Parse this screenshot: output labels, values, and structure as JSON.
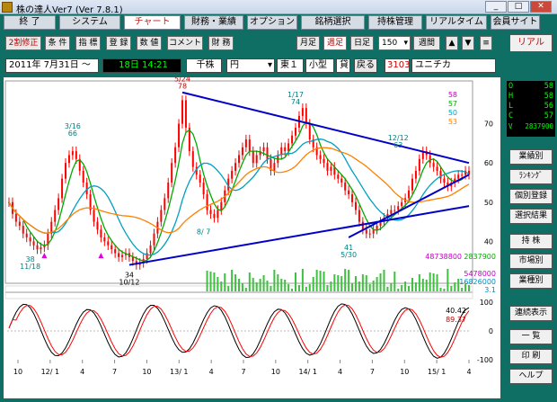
{
  "window": {
    "title": "株の達人Ver7 (Ver 7.8.1)"
  },
  "menu": {
    "items": [
      "終 了",
      "システム",
      "チャート",
      "財務・業績",
      "オプション",
      "銘柄選択",
      "持株管理",
      "リアルタイム",
      "会員サイト"
    ],
    "active_index": 2
  },
  "toolbar": {
    "split_label": "2割修正",
    "condition_label": "条 件",
    "indicator_label": "指 標",
    "register_label": "登 録",
    "value_label": "数 値",
    "comment_label": "コメント",
    "finance_label": "財 務",
    "monthly_label": "月足",
    "weekly_label": "週足",
    "daily_label": "日足",
    "bars_value": "150",
    "period_label": "週間",
    "up_label": "▲",
    "down_label": "▼",
    "menu_label": "≡"
  },
  "info": {
    "date": "2011年 7月31日 ～",
    "range_end": "18日 14:21",
    "unit": "千株",
    "currency": "円",
    "market": "東１",
    "size": "小型",
    "lending": "貸",
    "back_label": "戻る",
    "code": "3103",
    "name": "ユニチカ"
  },
  "ohlc": [
    {
      "k": "O",
      "v": "58"
    },
    {
      "k": "H",
      "v": "58"
    },
    {
      "k": "L",
      "v": "56"
    },
    {
      "k": "C",
      "v": "57"
    },
    {
      "k": "V",
      "v": "2837900"
    }
  ],
  "sidebar": {
    "items": [
      "リアル",
      "業績別",
      "ﾗﾝｷﾝｸﾞ",
      "個別登録",
      "選択結果",
      "持 株",
      "市場別",
      "業種別",
      "連続表示",
      "一 覧",
      "印 刷",
      "ヘルプ"
    ]
  },
  "colors": {
    "bg": "#0f6f64",
    "candle_up": "#ff0000",
    "candle_down": "#ff0000",
    "ma_short": "#00aa00",
    "ma_mid": "#00a0c0",
    "ma_long": "#ff8000",
    "trend": "#0000c8",
    "stoch_k": "#000000",
    "stoch_d": "#ff0000"
  },
  "chart_data": {
    "type": "line",
    "price_axis": {
      "ticks": [
        70,
        60,
        50,
        40
      ],
      "ylim": [
        30,
        80
      ]
    },
    "annotations": [
      {
        "text": "5/24",
        "sub": "78"
      },
      {
        "text": "1/17",
        "sub": "74"
      },
      {
        "text": "12/12",
        "sub": "63"
      },
      {
        "text": "3/16",
        "sub": "66"
      },
      {
        "text": "8/ 7",
        "sub": ""
      },
      {
        "text": "38",
        "sub": "11/18"
      },
      {
        "text": "34",
        "sub": "10/12"
      },
      {
        "text": "41",
        "sub": "5/30"
      }
    ],
    "ma_legend": [
      "58",
      "57",
      "50",
      "53"
    ],
    "volume_legend": {
      "vol_max": "48738800",
      "vol_last": "2837900",
      "ma1": "5478000",
      "ma2": "16826000",
      "ratio": "3.1"
    },
    "stoch_legend": {
      "k": "40.42",
      "d": "89.37",
      "ticks": [
        "100",
        "0",
        "-100"
      ]
    },
    "x_ticks": [
      "10",
      "12/ 1",
      "4",
      "7",
      "10",
      "13/ 1",
      "4",
      "7",
      "10",
      "14/ 1",
      "4",
      "7",
      "10",
      "15/ 1",
      "4"
    ],
    "close": [
      50,
      47,
      45,
      44,
      42,
      41,
      40,
      39,
      38,
      38.5,
      39,
      42,
      45,
      48,
      51,
      56,
      60,
      62,
      63,
      61,
      58,
      55,
      52,
      48,
      45,
      43,
      41,
      40,
      39,
      38,
      37,
      36,
      36.5,
      37,
      36,
      35,
      34,
      34.5,
      35.5,
      37,
      39,
      42,
      45,
      48,
      51,
      55,
      60,
      64,
      70,
      76,
      69,
      63,
      59,
      57,
      55,
      52,
      48,
      47,
      46,
      48,
      50,
      53,
      56,
      58,
      60,
      62,
      64,
      66,
      63,
      60,
      62,
      63,
      64,
      61,
      58,
      60,
      62,
      64,
      63,
      65,
      67,
      69,
      72,
      74,
      70,
      66,
      64,
      62,
      61,
      60,
      58,
      59,
      57,
      56,
      55,
      53,
      52,
      50,
      48,
      45,
      43,
      42,
      42,
      43,
      44,
      45,
      46,
      47,
      48,
      48,
      49,
      50,
      51,
      53,
      56,
      58,
      61,
      63,
      62,
      60,
      59,
      58,
      56,
      55,
      54,
      55,
      56,
      57,
      57,
      58,
      57
    ]
  }
}
